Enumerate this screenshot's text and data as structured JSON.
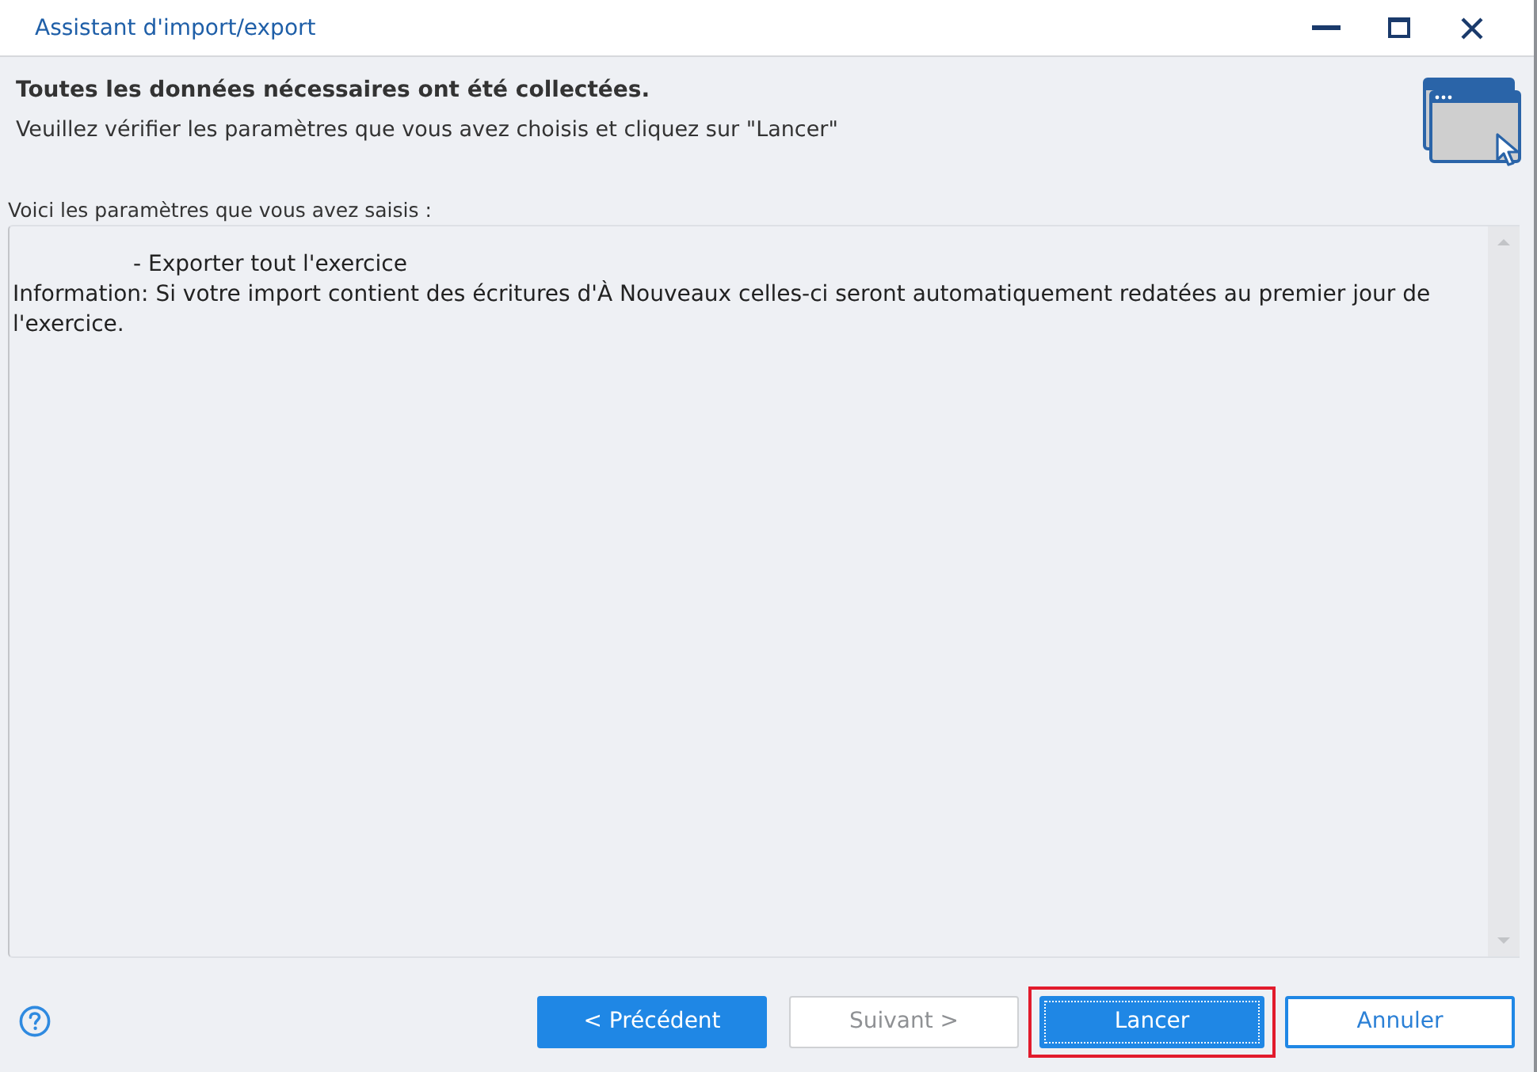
{
  "window": {
    "title": "Assistant d'import/export"
  },
  "header": {
    "title": "Toutes les données nécessaires ont été collectées.",
    "subtitle": "Veuillez vérifier les paramètres que vous avez choisis et cliquez sur \"Lancer\""
  },
  "summary": {
    "label": "Voici les paramètres que vous avez saisis :",
    "lines": [
      {
        "kind": "item",
        "text": "- Exporter tout l'exercice"
      },
      {
        "kind": "info",
        "text": "Information: Si votre import contient des écritures d'À Nouveaux celles-ci seront automatiquement redatées au premier jour de l'exercice."
      }
    ]
  },
  "buttons": [
    {
      "label": "< Précédent",
      "kind": "primary",
      "disabled": false,
      "focused": false,
      "highlighted": false
    },
    {
      "label": "Suivant >",
      "kind": "outline",
      "disabled": true,
      "focused": false,
      "highlighted": false
    },
    {
      "label": "Lancer",
      "kind": "primary",
      "disabled": false,
      "focused": true,
      "highlighted": true
    },
    {
      "label": "Annuler",
      "kind": "outline",
      "disabled": false,
      "focused": false,
      "highlighted": false
    }
  ]
}
